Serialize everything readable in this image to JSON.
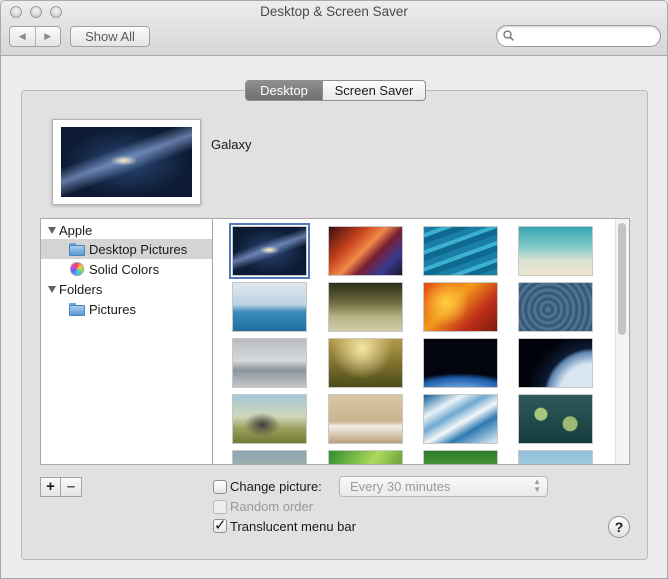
{
  "window": {
    "title": "Desktop & Screen Saver"
  },
  "toolbar": {
    "back_label": "◀",
    "forward_label": "▶",
    "show_all_label": "Show All",
    "search_placeholder": ""
  },
  "tabs": [
    {
      "label": "Desktop",
      "active": true
    },
    {
      "label": "Screen Saver",
      "active": false
    }
  ],
  "preview": {
    "name": "Galaxy"
  },
  "sidebar": {
    "items": [
      {
        "label": "Apple",
        "type": "group"
      },
      {
        "label": "Desktop Pictures",
        "type": "folder",
        "selected": true
      },
      {
        "label": "Solid Colors",
        "type": "colors"
      },
      {
        "label": "Folders",
        "type": "group"
      },
      {
        "label": "Pictures",
        "type": "folder"
      }
    ]
  },
  "thumbnails": [
    {
      "name": "galaxy",
      "selected": true
    },
    {
      "name": "antelope-canyon"
    },
    {
      "name": "water-waves"
    },
    {
      "name": "beach"
    },
    {
      "name": "frozen-lake"
    },
    {
      "name": "grass-field"
    },
    {
      "name": "autumn-leaves"
    },
    {
      "name": "ripples"
    },
    {
      "name": "foggy-lake"
    },
    {
      "name": "meadow-bird"
    },
    {
      "name": "earth-horizon"
    },
    {
      "name": "earth-limb"
    },
    {
      "name": "elephant"
    },
    {
      "name": "flamingos"
    },
    {
      "name": "ice-rivers"
    },
    {
      "name": "lily-pads"
    },
    {
      "name": "partial-1"
    },
    {
      "name": "partial-2"
    },
    {
      "name": "partial-3"
    },
    {
      "name": "partial-4"
    }
  ],
  "buttons": {
    "add_label": "+",
    "remove_label": "–",
    "help_label": "?"
  },
  "options": {
    "change_picture": {
      "label": "Change picture:",
      "checked": false
    },
    "interval": {
      "value": "Every 30 minutes",
      "arrows": "▲▼"
    },
    "random_order": {
      "label": "Random order",
      "checked": false,
      "disabled": true
    },
    "translucent_menu_bar": {
      "label": "Translucent menu bar",
      "checked": true,
      "mark": "✓"
    }
  }
}
